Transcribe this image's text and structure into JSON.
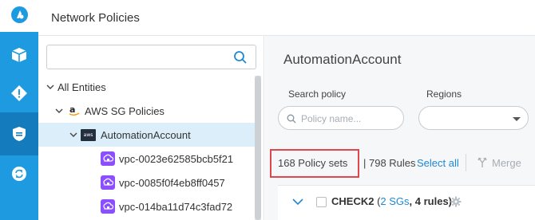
{
  "header": {
    "title": "Network Policies"
  },
  "rail": {
    "items": [
      {
        "icon": "package-icon"
      },
      {
        "icon": "alert-diamond-icon"
      },
      {
        "icon": "shield-icon",
        "active": true
      },
      {
        "icon": "sync-icon"
      }
    ]
  },
  "tree": {
    "search_placeholder": "",
    "rows": [
      {
        "label": "All Entities"
      },
      {
        "label": "AWS SG Policies"
      },
      {
        "label": "AutomationAccount",
        "selected": true,
        "badge": "aws"
      },
      {
        "label": "vpc-0023e62585bcb5f21"
      },
      {
        "label": "vpc-0085f0f4eb8ff0457"
      },
      {
        "label": "vpc-014ba11d74c3fad72"
      }
    ]
  },
  "main": {
    "account_title": "AutomationAccount",
    "search_label": "Search policy",
    "search_placeholder": "Policy name...",
    "regions_label": "Regions",
    "regions_value": "",
    "policy_sets": "168 Policy sets",
    "rules": "| 798 Rules",
    "select_all": "Select all",
    "merge": "Merge",
    "row": {
      "name": "CHECK2",
      "open_paren": " (",
      "sgs": "2 SGs",
      "rules": ", 4 rules)"
    }
  },
  "colors": {
    "accent": "#1e9be0",
    "rail_active": "#147bbd",
    "highlight": "#e0474c",
    "link": "#1e88d2",
    "vpc_icon": "#8c4fff"
  }
}
